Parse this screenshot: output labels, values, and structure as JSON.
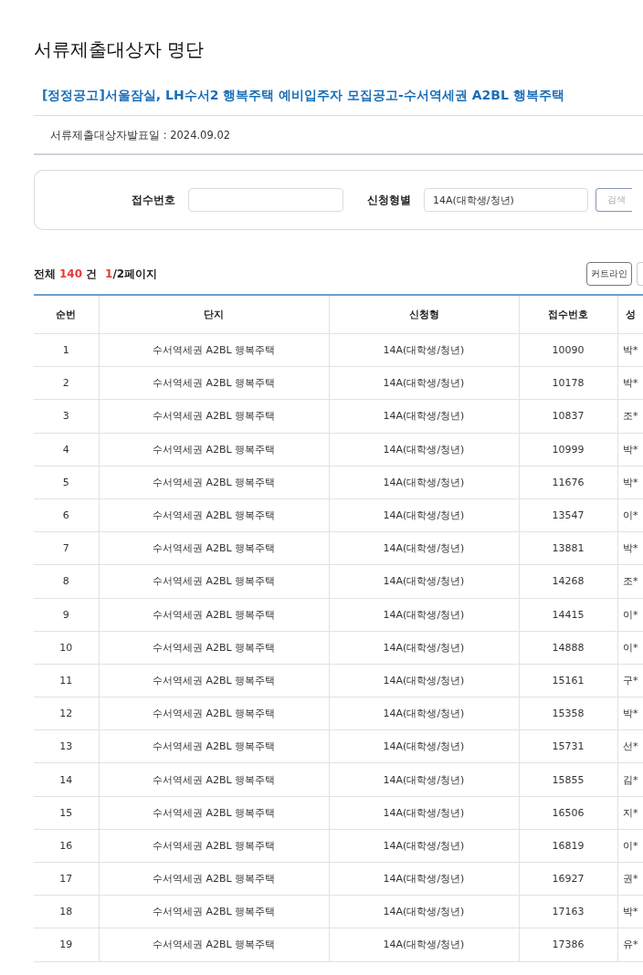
{
  "page_title": "서류제출대상자 명단",
  "notice_title": "[정정공고]서울잠실, LH수서2 행복주택 예비입주자 모집공고-수서역세권 A2BL 행복주택",
  "announce_date": "서류제출대상자발표일 : 2024.09.02",
  "search": {
    "fields": [
      {
        "kind": "text",
        "label": "접수번호"
      },
      {
        "kind": "select",
        "label": "신청형별",
        "value": "14A(대학생/청년)"
      }
    ],
    "button": "검색"
  },
  "summary": {
    "prefix": "전체",
    "count": "140",
    "unit": "건",
    "page_current": "1",
    "page_total": "/2페이지"
  },
  "cutline_button": "커트라인",
  "table": {
    "columns": [
      "순번",
      "단지",
      "신청형",
      "접수번호",
      "성"
    ],
    "rows": [
      [
        "1",
        "수서역세권 A2BL 행복주택",
        "14A(대학생/청년)",
        "10090",
        "박*"
      ],
      [
        "2",
        "수서역세권 A2BL 행복주택",
        "14A(대학생/청년)",
        "10178",
        "박*"
      ],
      [
        "3",
        "수서역세권 A2BL 행복주택",
        "14A(대학생/청년)",
        "10837",
        "조*"
      ],
      [
        "4",
        "수서역세권 A2BL 행복주택",
        "14A(대학생/청년)",
        "10999",
        "박*"
      ],
      [
        "5",
        "수서역세권 A2BL 행복주택",
        "14A(대학생/청년)",
        "11676",
        "박*"
      ],
      [
        "6",
        "수서역세권 A2BL 행복주택",
        "14A(대학생/청년)",
        "13547",
        "이*"
      ],
      [
        "7",
        "수서역세권 A2BL 행복주택",
        "14A(대학생/청년)",
        "13881",
        "박*"
      ],
      [
        "8",
        "수서역세권 A2BL 행복주택",
        "14A(대학생/청년)",
        "14268",
        "조*"
      ],
      [
        "9",
        "수서역세권 A2BL 행복주택",
        "14A(대학생/청년)",
        "14415",
        "이*"
      ],
      [
        "10",
        "수서역세권 A2BL 행복주택",
        "14A(대학생/청년)",
        "14888",
        "이*"
      ],
      [
        "11",
        "수서역세권 A2BL 행복주택",
        "14A(대학생/청년)",
        "15161",
        "구*"
      ],
      [
        "12",
        "수서역세권 A2BL 행복주택",
        "14A(대학생/청년)",
        "15358",
        "박*"
      ],
      [
        "13",
        "수서역세권 A2BL 행복주택",
        "14A(대학생/청년)",
        "15731",
        "선*"
      ],
      [
        "14",
        "수서역세권 A2BL 행복주택",
        "14A(대학생/청년)",
        "15855",
        "김*"
      ],
      [
        "15",
        "수서역세권 A2BL 행복주택",
        "14A(대학생/청년)",
        "16506",
        "지*"
      ],
      [
        "16",
        "수서역세권 A2BL 행복주택",
        "14A(대학생/청년)",
        "16819",
        "이*"
      ],
      [
        "17",
        "수서역세권 A2BL 행복주택",
        "14A(대학생/청년)",
        "16927",
        "권*"
      ],
      [
        "18",
        "수서역세권 A2BL 행복주택",
        "14A(대학생/청년)",
        "17163",
        "박*"
      ],
      [
        "19",
        "수서역세권 A2BL 행복주택",
        "14A(대학생/청년)",
        "17386",
        "유*"
      ]
    ]
  }
}
